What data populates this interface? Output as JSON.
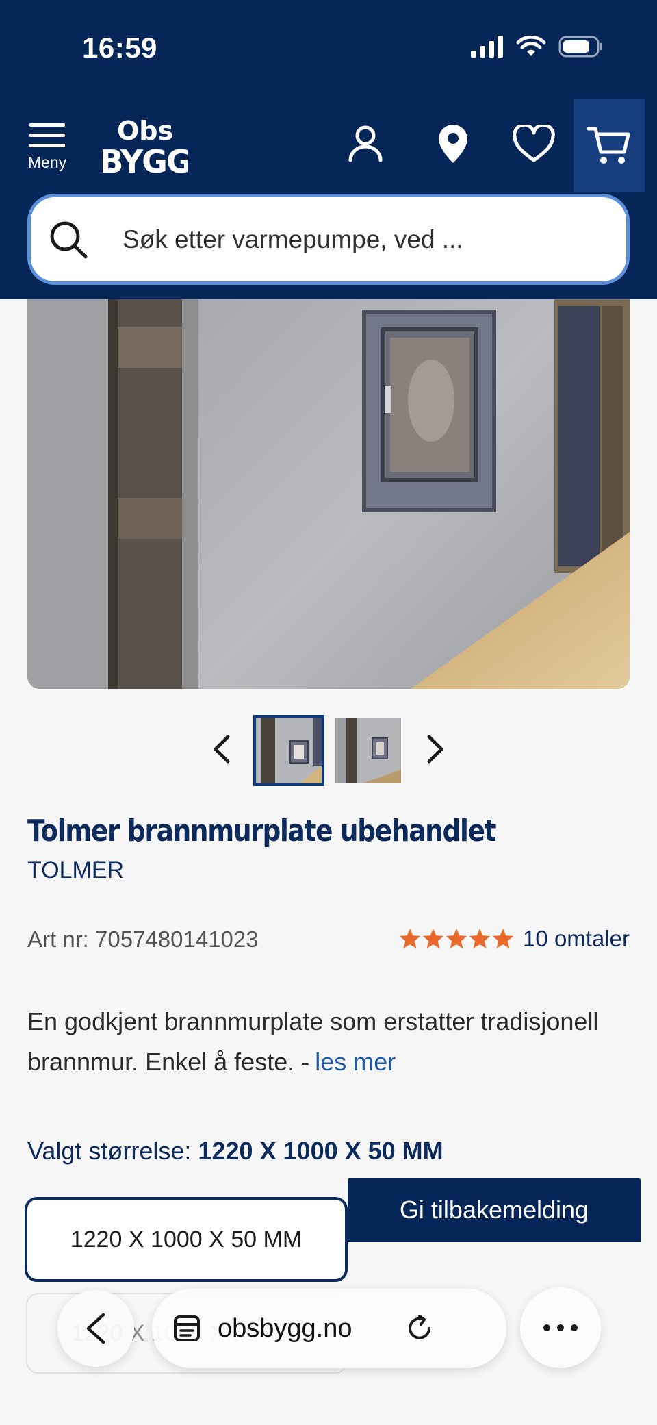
{
  "status_bar": {
    "time": "16:59"
  },
  "header": {
    "menu_label": "Meny",
    "logo_line1": "Obs",
    "logo_line2": "BYGG"
  },
  "search": {
    "placeholder": "Søk etter varmepumpe, ved ..."
  },
  "product": {
    "title": "Tolmer brannmurplate ubehandlet",
    "brand": "TOLMER",
    "art_nr": "Art nr: 7057480141023",
    "rating": 5,
    "reviews": "10 omtaler",
    "description": "En godkjent brannmurplate som erstatter tradisjonell brannmur. Enkel å feste. -",
    "read_more": "les mer",
    "size_label_prefix": "Valgt størrelse:",
    "size_selected": "1220 X 1000 X 50 MM",
    "size_options": [
      "1220 X 1000 X 50 MM",
      "1220 X 1000 X 50 MM"
    ]
  },
  "feedback_button": "Gi tilbakemelding",
  "browser": {
    "url": "obsbygg.no"
  },
  "colors": {
    "navy": "#062658",
    "accent_blue": "#1d5aa6",
    "star": "#e8692a"
  }
}
